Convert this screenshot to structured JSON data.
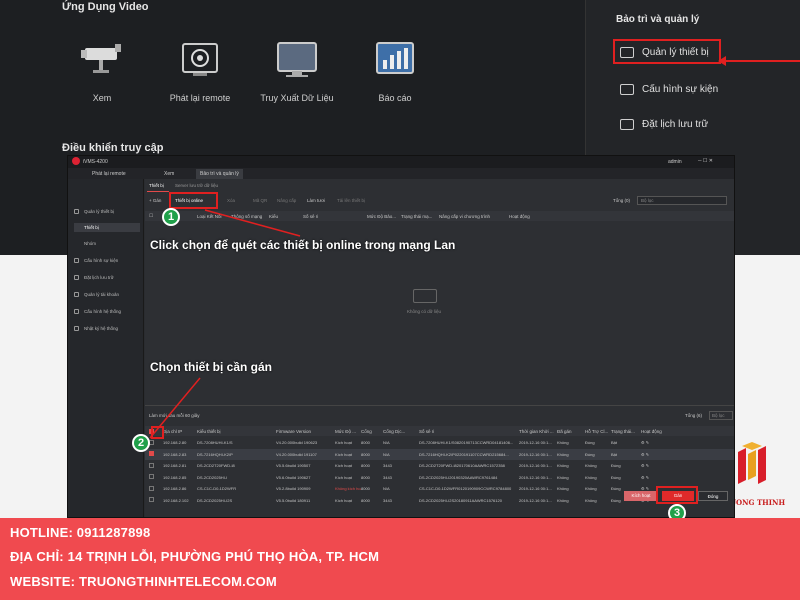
{
  "top": {
    "video_section_title": "Ứng Dụng Video",
    "control_section_title": "Điều khiển truy cập",
    "apps": [
      {
        "label": "Xem",
        "icon": "camera-icon"
      },
      {
        "label": "Phát lại remote",
        "icon": "playback-icon"
      },
      {
        "label": "Truy Xuất Dữ Liệu",
        "icon": "monitor-icon"
      },
      {
        "label": "Báo cáo",
        "icon": "report-chart-icon"
      }
    ],
    "maintenance_title": "Bảo trì và quản lý",
    "maintenance_items": [
      {
        "label": "Quản lý thiết bị"
      },
      {
        "label": "Cấu hình sự kiện"
      },
      {
        "label": "Đặt lịch lưu trữ"
      }
    ]
  },
  "window": {
    "app_name": "iVMS-4200",
    "tabs": [
      "Phát lại remote",
      "Xem",
      "Bảo trì và quản lý"
    ],
    "user": "admin",
    "sidebar": [
      "Quản lý thiết bị",
      "Thiết bị",
      "Nhóm",
      "Cấu hình sự kiện",
      "Đặt lịch lưu trữ",
      "Quản lý tài khoản",
      "Cấu hình hệ thống",
      "Nhật ký hệ thống"
    ],
    "subtabs": [
      "Thiết bị",
      "Server lưu trữ dữ liệu"
    ],
    "toolbar": [
      "+ Gán",
      "Thiết bị online",
      "Xóa",
      "Mã QR",
      "Nâng cấp",
      "Làm tươi",
      "Tải lên thiết bị"
    ],
    "total_label": "Tổng (0)",
    "search_placeholder": "Bộ lọc",
    "top_columns": [
      "Tên",
      "Loại Kết Nối",
      "Thông số mạng",
      "Kiểu",
      "Số sê ri",
      "Mức Độ Bảo...",
      "Trạng thái mạ...",
      "Nâng cấp vi chương trình",
      "Hoạt động"
    ],
    "empty_text": "Không có dữ liệu",
    "refresh_label": "Làm mới sau mỗi 60 giây",
    "total2_label": "Tổng (6)",
    "bottom_columns": [
      "Địa chỉ IP",
      "Kiểu thiết bị",
      "Firmware Version",
      "Mức Độ ...",
      "Cổng",
      "Cổng Dịc...",
      "Số sê ri",
      "Thời gian Khởi ...",
      "Đã gán",
      "Hỗ Trợ Cl...",
      "Trạng thái...",
      "Hoạt động"
    ],
    "rows": [
      [
        "192.168.2.80",
        "DS-7208HUHI-K1/S",
        "V4.20.000build 190623",
        "Kích hoạt",
        "8000",
        "N/A",
        "DS-7208HUHI-K1/S0820190713CCWRD04181406...",
        "2019-12-16 00:1...",
        "Không",
        "Đúng",
        "Bật"
      ],
      [
        "192.168.2.83",
        "DS-7216HQHI-K2/P",
        "V4.20.000build 191107",
        "Kích hoạt",
        "8000",
        "N/A",
        "DS-7216HQHI-K2/P0220191107CCWRD215684...",
        "2019-12-16 00:1...",
        "Không",
        "Đúng",
        "Bật"
      ],
      [
        "192.168.2.81",
        "DS-2CD2T20FWD-I8",
        "V5.5.6build 190507",
        "Kích hoạt",
        "8000",
        "3443",
        "DS-2CD2T20FWD-I820170610AAWRC1572358",
        "2019-12-16 00:1...",
        "Không",
        "Không",
        "Đúng"
      ],
      [
        "192.168.2.85",
        "DS-2CD2025HI-I",
        "V5.6.0build 190627",
        "Kích hoạt",
        "8000",
        "3443",
        "DS-2CD2025HI-I20190320AAWRC9761484",
        "2019-12-16 00:1...",
        "Không",
        "Không",
        "Đúng"
      ],
      [
        "192.168.2.86",
        "CS-C1C-D0-1D2WFR",
        "V5.2.8build 190909",
        "Không kích hoạt",
        "8000",
        "N/A",
        "CS-C1C-D0-1D2WFR0120190909CCWRC9784800",
        "2019-12-16 00:1...",
        "Không",
        "Không",
        "Đúng"
      ],
      [
        "192.168.2.102",
        "DS-2CD2025HI-I2S",
        "V5.5.0build 180911",
        "Kích hoạt",
        "8000",
        "3443",
        "DS-2CD2025HI-I2S20180911AAWRC1576120",
        "2019-12-16 00:1...",
        "Không",
        "Không",
        "Đúng"
      ]
    ],
    "btn_activate": "Kích hoạt",
    "btn_assign": "Gán",
    "btn_close": "Đóng"
  },
  "annotations": {
    "badge1": "1",
    "badge2": "2",
    "badge3": "3",
    "caption1": "Click chọn để quét các thiết bị online trong mạng Lan",
    "caption2": "Chọn thiết bị cần gán"
  },
  "logo_name": "TRUONG THINH",
  "footer": {
    "hotline": "HOTLINE: 0911287898",
    "address": "ĐỊA CHỈ: 14 TRỊNH LỖI, PHƯỜNG PHÚ THỌ HÒA, TP. HCM",
    "website": "WEBSITE: TRUONGTHINHTELECOM.COM"
  },
  "colors": {
    "accent_red": "#e02020",
    "footer_red": "#f04a4f",
    "badge_green": "#20a04a"
  }
}
